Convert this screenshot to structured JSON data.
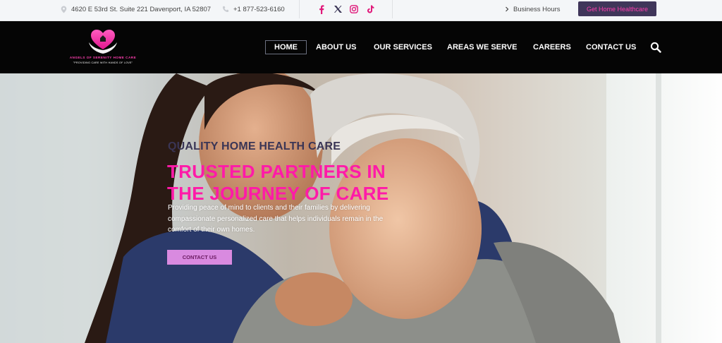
{
  "topbar": {
    "address": "4620 E 53rd St. Suite 221 Davenport, IA 52807",
    "phone": "+1 877-523-6160",
    "social_icons": [
      "facebook-icon",
      "x-icon",
      "instagram-icon",
      "tiktok-icon"
    ],
    "hours_label": "Business Hours",
    "cta_label": "Get Home Healthcare"
  },
  "brand": {
    "name": "ANGELS OF SERENITY HOME CARE",
    "tagline": "\"PROVIDING CARE WITH HANDS OF LOVE\"",
    "icon": "heart-hands-logo"
  },
  "nav": {
    "items": [
      "HOME",
      "ABOUT US",
      "OUR SERVICES",
      "AREAS WE SERVE",
      "CAREERS",
      "CONTACT US"
    ],
    "active": "HOME",
    "search_icon": "search-icon"
  },
  "hero": {
    "eyebrow": "QUALITY HOME HEALTH CARE",
    "title": "TRUSTED PARTNERS IN THE JOURNEY OF CARE",
    "description": "Providing peace of mind to clients and their families by delivering compassionate personalized care that helps individuals remain in the comfort of their own homes.",
    "cta_label": "CONTACT US"
  },
  "colors": {
    "accent_pink": "#ff1aa8",
    "nav_bg": "#050505",
    "topbar_cta_bg": "#40365a",
    "hero_cta_bg": "#d98ae0",
    "eyebrow": "#3a3555"
  }
}
